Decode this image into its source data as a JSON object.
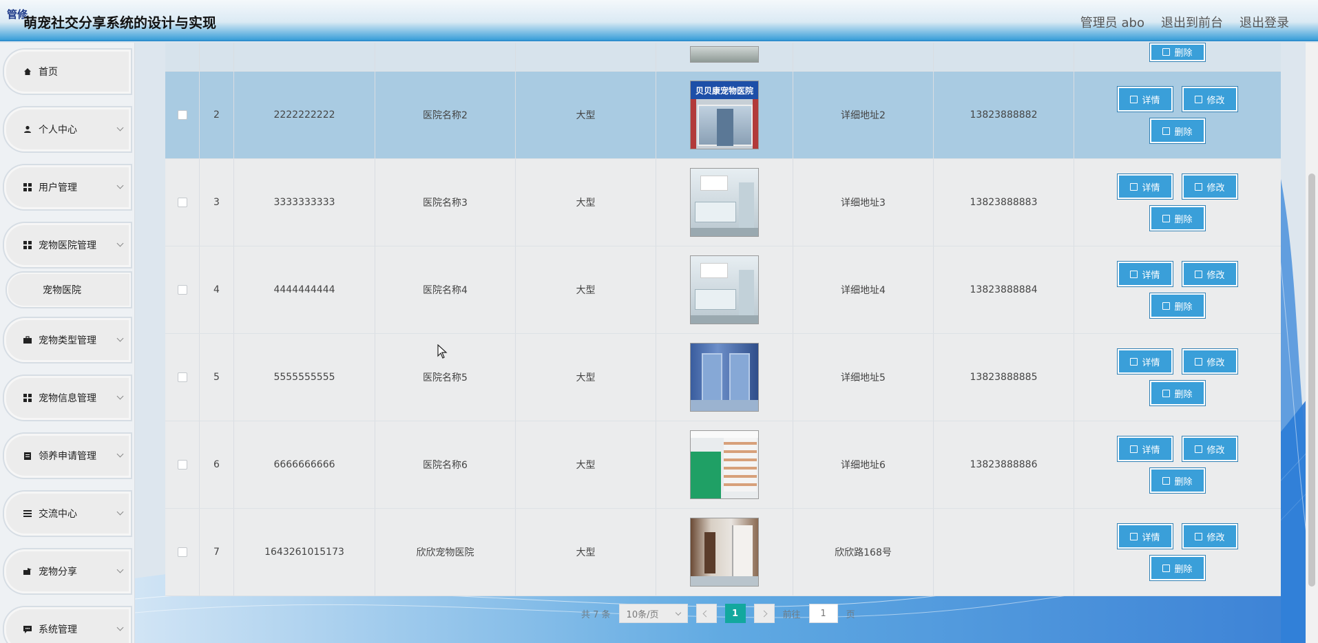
{
  "header": {
    "badge": "管修",
    "title": "萌宠社交分享系统的设计与实现",
    "nav": [
      "管理员 abo",
      "退出到前台",
      "退出登录"
    ]
  },
  "sidebar": {
    "items": [
      {
        "label": "首页",
        "icon": "home-icon"
      },
      {
        "label": "个人中心",
        "icon": "user-icon"
      },
      {
        "label": "用户管理",
        "icon": "grid-icon"
      },
      {
        "label": "宠物医院管理",
        "icon": "grid-icon"
      },
      {
        "label": "宠物类型管理",
        "icon": "briefcase-icon"
      },
      {
        "label": "宠物信息管理",
        "icon": "grid-icon"
      },
      {
        "label": "领养申请管理",
        "icon": "clipboard-icon"
      },
      {
        "label": "交流中心",
        "icon": "list-icon"
      },
      {
        "label": "宠物分享",
        "icon": "share-icon"
      },
      {
        "label": "系统管理",
        "icon": "chat-icon"
      }
    ],
    "submenu": "宠物医院"
  },
  "buttons": {
    "detail": "详情",
    "edit": "修改",
    "delete": "删除"
  },
  "rows": [
    {
      "index": "2",
      "code": "2222222222",
      "name": "医院名称2",
      "size": "大型",
      "address": "详细地址2",
      "phone": "13823888882",
      "photo_sign": "贝贝康宠物医院"
    },
    {
      "index": "3",
      "code": "3333333333",
      "name": "医院名称3",
      "size": "大型",
      "address": "详细地址3",
      "phone": "13823888883"
    },
    {
      "index": "4",
      "code": "4444444444",
      "name": "医院名称4",
      "size": "大型",
      "address": "详细地址4",
      "phone": "13823888884"
    },
    {
      "index": "5",
      "code": "5555555555",
      "name": "医院名称5",
      "size": "大型",
      "address": "详细地址5",
      "phone": "13823888885"
    },
    {
      "index": "6",
      "code": "6666666666",
      "name": "医院名称6",
      "size": "大型",
      "address": "详细地址6",
      "phone": "13823888886"
    },
    {
      "index": "7",
      "code": "1643261015173",
      "name": "欣欣宠物医院",
      "size": "大型",
      "address": "欣欣路168号",
      "phone": ""
    }
  ],
  "pagination": {
    "total": "共 7 条",
    "page_size": "10条/页",
    "current": "1",
    "goto_label": "前往",
    "goto_value": "1",
    "page_suffix": "页"
  },
  "colors": {
    "accent": "#3a9fd9",
    "selected_row": "#a9cbe2",
    "pager_active": "#13a89e"
  }
}
